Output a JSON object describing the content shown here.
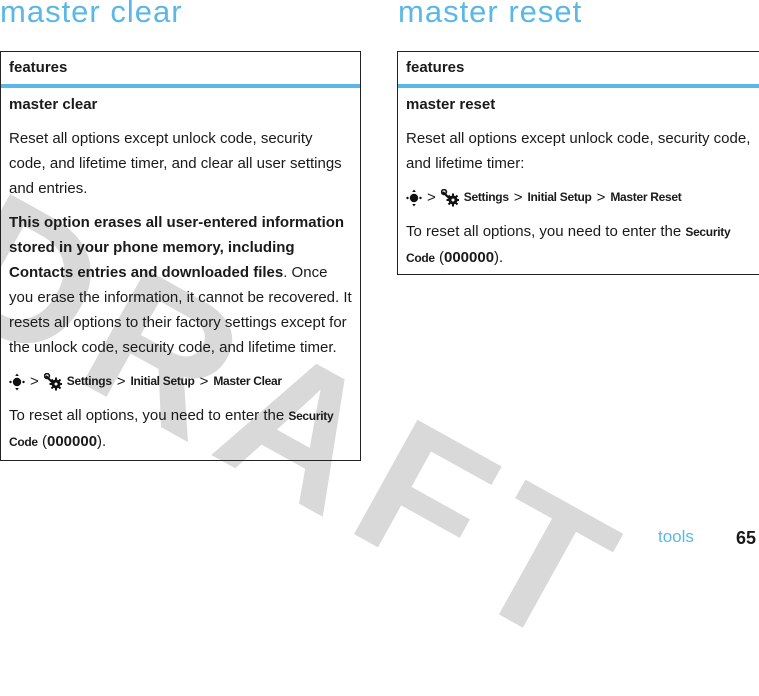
{
  "watermark": "DRAFT",
  "colors": {
    "accent": "#5bb8e6",
    "watermark": "#d9d9d9",
    "text": "#1a1a1a"
  },
  "left": {
    "heading": "master clear",
    "table_header": "features",
    "row_title": "master clear",
    "description": "Reset all options except unlock code, security code, and lifetime timer, and clear all user settings and entries.",
    "warning_bold": "This option erases all user-entered information stored in your phone memory, including Contacts entries and downloaded files",
    "warning_rest": ". Once you erase the information, it cannot be recovered. It resets all options to their factory settings except for the unlock code, security code, and lifetime timer.",
    "nav": {
      "icons": [
        "nav-key-icon",
        "settings-icon"
      ],
      "separator": ">",
      "path": [
        "Settings",
        "Initial Setup",
        "Master Clear"
      ]
    },
    "code_text_before": "To reset all options, you need to enter the ",
    "code_label": "Security Code",
    "code_open": " (",
    "code_value": "000000",
    "code_close": ")."
  },
  "right": {
    "heading": "master reset",
    "table_header": "features",
    "row_title": "master reset",
    "description": "Reset all options except unlock code, security code, and lifetime timer:",
    "nav": {
      "icons": [
        "nav-key-icon",
        "settings-icon"
      ],
      "separator": ">",
      "path": [
        "Settings",
        "Initial Setup",
        "Master Reset"
      ]
    },
    "code_text_before": "To reset all options, you need to enter the ",
    "code_label": "Security Code",
    "code_open": " (",
    "code_value": "000000",
    "code_close": ")."
  },
  "footer": {
    "section": "tools",
    "page_number": "65"
  }
}
